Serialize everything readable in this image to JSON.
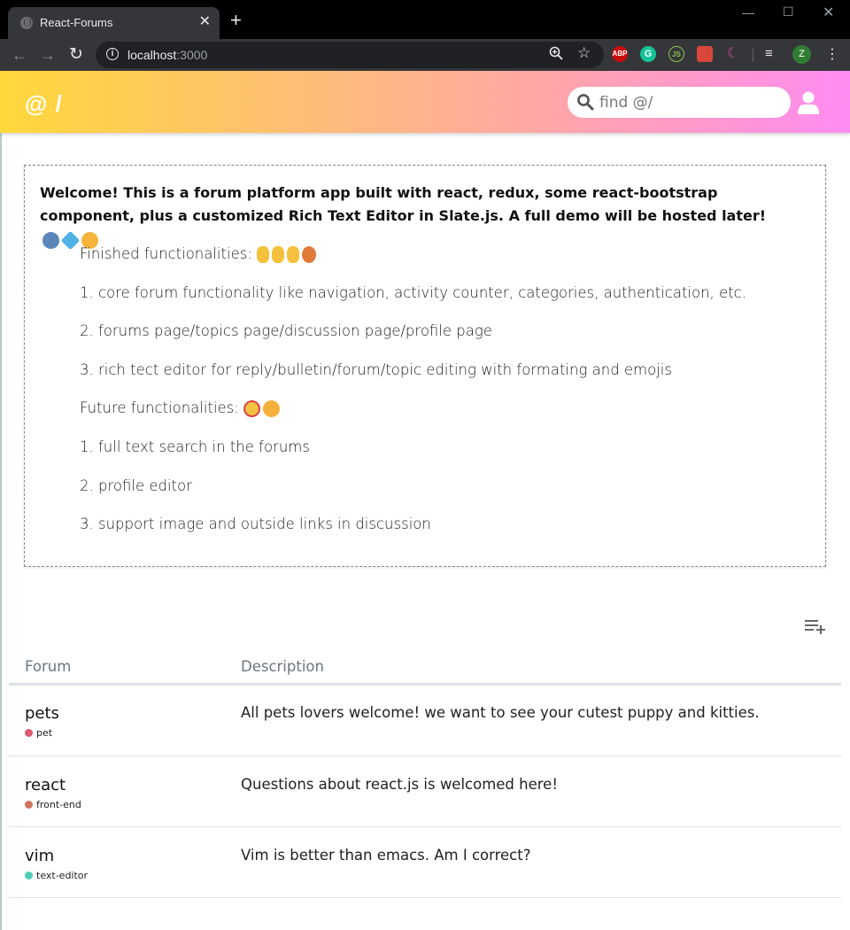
{
  "browser": {
    "tab_title": "React-Forums",
    "tab_close": "✕",
    "new_tab": "+",
    "url_host": "localhost",
    "url_port": ":3000",
    "extensions": {
      "abp": "ABP",
      "grammarly": "G",
      "js": "JS",
      "avatar_letter": "Z"
    }
  },
  "header": {
    "logo": "@ /",
    "search_placeholder": "find @/"
  },
  "welcome": {
    "title": "Welcome! This is a forum platform app built with react, redux, some react-bootstrap component, plus a customized Rich Text Editor in Slate.js. A full demo will be hosted later!",
    "finished_heading": "Finished functionalities:",
    "finished": [
      "1. core forum functionality like navigation, activity counter, categories, authentication, etc.",
      "2. forums page/topics page/discussion page/profile page",
      "3. rich tect editor for reply/bulletin/forum/topic editing with formating and emojis"
    ],
    "future_heading": "Future functionalities:",
    "future": [
      "1. full text search in the forums",
      "2. profile editor",
      "3. support image and outside links in discussion"
    ]
  },
  "table": {
    "headers": {
      "forum": "Forum",
      "description": "Description"
    },
    "rows": [
      {
        "name": "pets",
        "tag": "pet",
        "tag_color": "#dc5a6e",
        "description": "All pets lovers welcome! we want to see your cutest puppy and kitties."
      },
      {
        "name": "react",
        "tag": "front-end",
        "tag_color": "#d2735f",
        "description": "Questions about react.js is welcomed here!"
      },
      {
        "name": "vim",
        "tag": "text-editor",
        "tag_color": "#4ecdb4",
        "description": "Vim is better than emacs. Am I correct?"
      }
    ]
  },
  "icons": {
    "search": "search-icon",
    "user": "user-icon",
    "add_forum": "playlist-add-icon"
  }
}
